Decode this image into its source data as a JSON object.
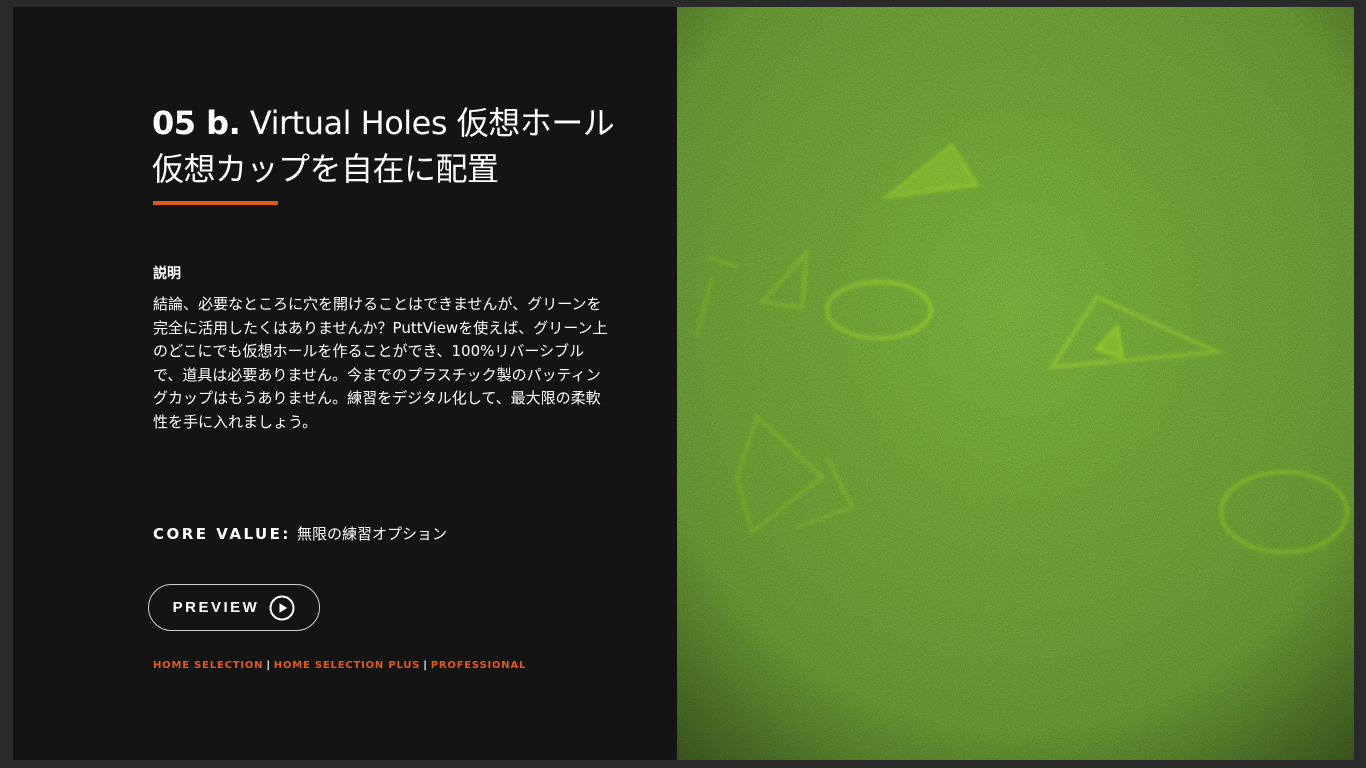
{
  "slide": {
    "title_number": "05 b.",
    "title_line1": " Virtual Holes 仮想ホール",
    "title_line2": "仮想カップを自在に配置",
    "section_label": "説明",
    "description": "結論、必要なところに穴を開けることはできませんが、グリーンを完全に活用したくはありませんか？PuttViewを使えば、グリーン上のどこにでも仮想ホールを作ることができ、100%リバーシブルで、道具は必要ありません。今までのプラスチック製のパッティングカップはもうありません。練習をデジタル化して、最大限の柔軟性を手に入れましょう。",
    "core_value_label": "CORE VALUE:",
    "core_value_text": "無限の練習オプション",
    "preview_label": "PREVIEW",
    "preview_icon": "play-circle-icon",
    "editions": [
      "HOME SELECTION",
      "HOME SELECTION PLUS",
      "PROFESSIONAL"
    ],
    "edition_separator": "|"
  },
  "colors": {
    "background": "#141414",
    "accent": "#e05a1c",
    "text": "#ffffff",
    "grass": "#3d6a12",
    "projection": "#a8e02a"
  }
}
